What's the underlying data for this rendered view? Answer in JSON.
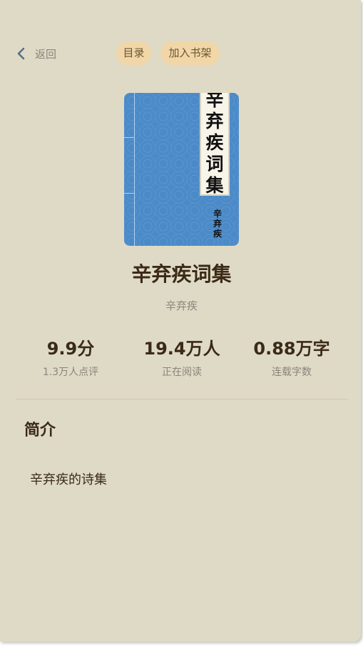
{
  "header": {
    "back_label": "返回",
    "toc_label": "目录",
    "add_shelf_label": "加入书架"
  },
  "cover": {
    "title_chars": [
      "辛",
      "弃",
      "疾",
      "词",
      "集"
    ],
    "seal_chars": [
      "辛",
      "弃",
      "疾"
    ],
    "background_color": "#4b8ac8"
  },
  "book": {
    "title": "辛弃疾词集",
    "author": "辛弃疾"
  },
  "stats": [
    {
      "value": "9.9分",
      "label": "1.3万人点评"
    },
    {
      "value": "19.4万人",
      "label": "正在阅读"
    },
    {
      "value": "0.88万字",
      "label": "连载字数"
    }
  ],
  "intro": {
    "heading": "简介",
    "text": "辛弃疾的诗集"
  },
  "colors": {
    "background": "#dfdac6",
    "pill": "#f1d7a8",
    "title_text": "#3b2a16",
    "muted_text": "#8a847a"
  },
  "icons": {
    "back": "chevron-left-icon"
  }
}
